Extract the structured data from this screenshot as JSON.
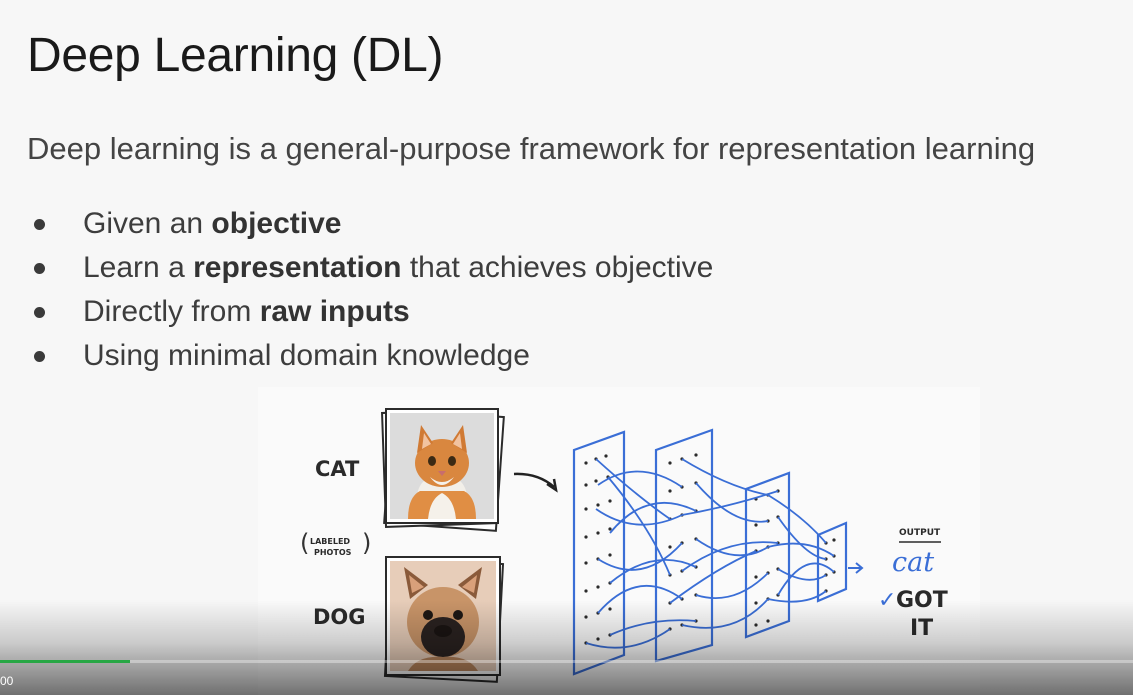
{
  "slide": {
    "title": "Deep Learning (DL)",
    "subtitle": "Deep learning is a general-purpose framework for representation learning",
    "bullets": [
      {
        "pre": "Given an ",
        "bold": "objective",
        "post": ""
      },
      {
        "pre": "Learn a ",
        "bold": "representation",
        "post": " that achieves objective"
      },
      {
        "pre": "Directly from ",
        "bold": "raw inputs",
        "post": ""
      },
      {
        "pre": "Using minimal domain knowledge",
        "bold": "",
        "post": ""
      }
    ]
  },
  "figure": {
    "cat_label": "CAT",
    "labeled_line1": "LABELED",
    "labeled_line2": "PHOTOS",
    "dog_label": "DOG",
    "output_heading": "OUTPUT",
    "output_value": "cat",
    "check_mark": "✓",
    "got_line1": "GOT",
    "got_line2": "IT"
  },
  "player": {
    "time": "00",
    "progress_fraction": 0.115,
    "accent_color": "#28a745"
  }
}
